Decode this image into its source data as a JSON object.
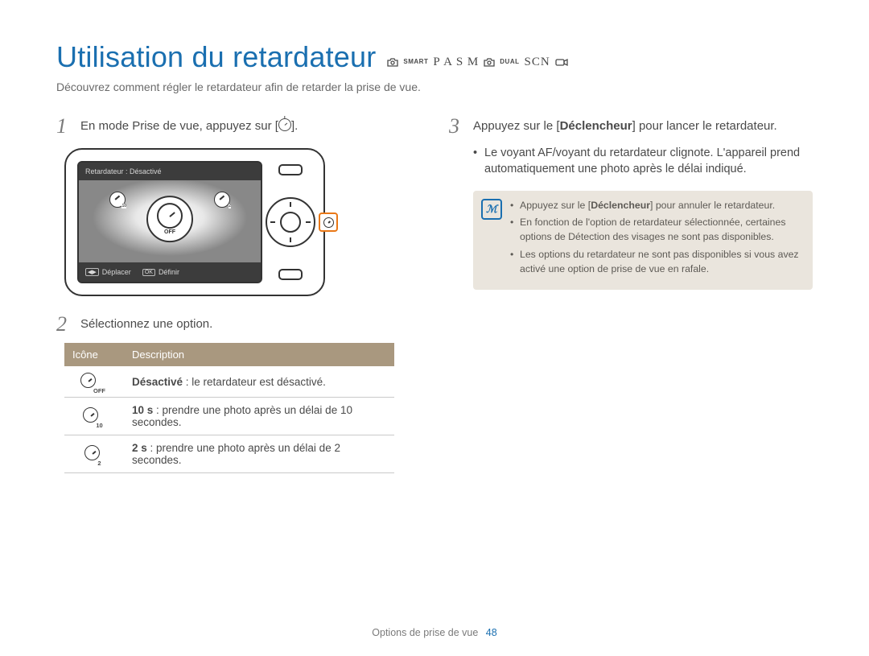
{
  "title": "Utilisation du retardateur",
  "modes": {
    "smart": "SMART",
    "pasm": "P A S M",
    "dual": "DUAL",
    "scn": "SCN"
  },
  "subtitle": "Découvrez comment régler le retardateur afin de retarder la prise de vue.",
  "step1": {
    "num": "1",
    "pre": "En mode Prise de vue, appuyez sur [",
    "post": "]."
  },
  "screen": {
    "status": "Retardateur : Désactivé",
    "move_key": "◀▶",
    "move": "Déplacer",
    "ok_key": "OK",
    "set": "Définir",
    "off": "OFF",
    "mini_left": "10",
    "mini_right": "2"
  },
  "step2": {
    "num": "2",
    "text": "Sélectionnez une option."
  },
  "table": {
    "h_icon": "Icône",
    "h_desc": "Description",
    "r1_sub": "OFF",
    "r1_bold": "Désactivé",
    "r1_rest": " : le retardateur est désactivé.",
    "r2_sub": "10",
    "r2_bold": "10 s",
    "r2_rest": " : prendre une photo après un délai de 10 secondes.",
    "r3_sub": "2",
    "r3_bold": "2 s",
    "r3_rest": " : prendre une photo après un délai de 2 secondes."
  },
  "step3": {
    "num": "3",
    "pre": "Appuyez sur le [",
    "btn": "Déclencheur",
    "post": "] pour lancer le retardateur."
  },
  "step3_bullets": [
    "Le voyant AF/voyant du retardateur clignote. L'appareil prend automatiquement une photo après le délai indiqué."
  ],
  "note": {
    "n1_pre": "Appuyez sur le [",
    "n1_btn": "Déclencheur",
    "n1_post": "] pour annuler le retardateur.",
    "n2": "En fonction de l'option de retardateur sélectionnée, certaines options de Détection des visages ne sont pas disponibles.",
    "n3": "Les options du retardateur ne sont pas disponibles si vous avez activé une option de prise de vue en rafale."
  },
  "footer": {
    "section": "Options de prise de vue",
    "page": "48"
  }
}
